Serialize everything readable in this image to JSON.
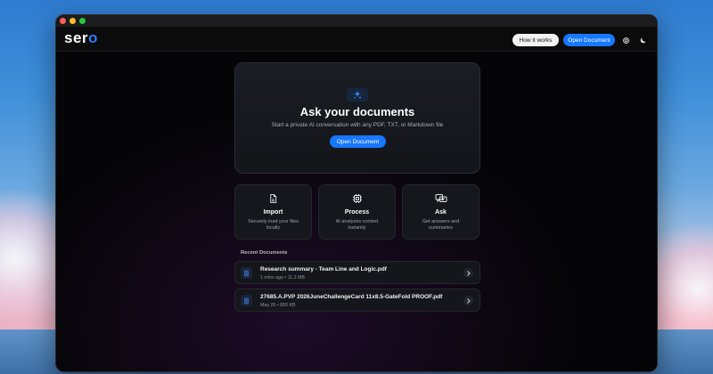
{
  "app": {
    "logo": "ser",
    "logo_accent": "o"
  },
  "header": {
    "how_it_works": "How it works",
    "open_document": "Open Document",
    "icons": [
      "gear-icon",
      "moon-icon"
    ]
  },
  "hero": {
    "icon": "sparkles-icon",
    "title": "Ask your documents",
    "subtitle": "Start a private AI conversation with any PDF, TXT, or Markdown file",
    "button": "Open Document"
  },
  "features": [
    {
      "icon": "file-icon",
      "title": "Import",
      "desc": "Securely load your files locally"
    },
    {
      "icon": "chip-icon",
      "title": "Process",
      "desc": "AI analyzes context instantly"
    },
    {
      "icon": "chat-icon",
      "title": "Ask",
      "desc": "Get answers and summaries"
    }
  ],
  "recent": {
    "label": "Recent Documents",
    "items": [
      {
        "name": "Research summary - Team Line and Logic.pdf",
        "meta": "1 mins ago • 11.2 MB"
      },
      {
        "name": "27685.A.PVP 2026JuneChallengeCard 11x8.5-GateFold PROOF.pdf",
        "meta": "May 25 • 850 KB"
      }
    ]
  },
  "colors": {
    "accent": "#1677ff",
    "background": "#050507",
    "card": "#15171c"
  }
}
